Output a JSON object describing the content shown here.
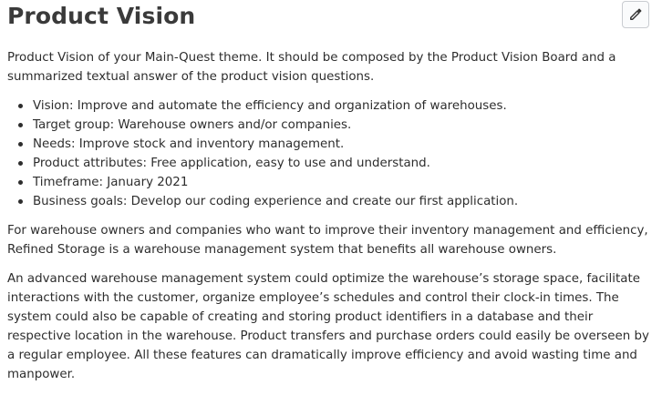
{
  "header": {
    "title": "Product Vision",
    "edit_icon": "pencil-icon"
  },
  "content": {
    "intro": "Product Vision of your Main-Quest theme. It should be composed by the Product Vision Board and a summarized textual answer of the product vision questions.",
    "bullets": [
      "Vision: Improve and automate the efficiency and organization of warehouses.",
      "Target group: Warehouse owners and/or companies.",
      "Needs: Improve stock and inventory management.",
      "Product attributes: Free application, easy to use and understand.",
      "Timeframe: January 2021",
      "Business goals: Develop our coding experience and create our first application."
    ],
    "paragraph_1": "For warehouse owners and companies who want to improve their inventory management and efficiency, Refined Storage is a warehouse management system that benefits all warehouse owners.",
    "paragraph_2": "An advanced warehouse management system could optimize the warehouse’s storage space, facilitate interactions with the customer, organize employee’s schedules and control their clock-in times. The system could also be capable of creating and storing product identifiers in a database and their respective location in the warehouse. Product transfers and purchase orders could easily be overseen by a regular employee. All these features can dramatically improve efficiency and avoid wasting time and manpower."
  }
}
